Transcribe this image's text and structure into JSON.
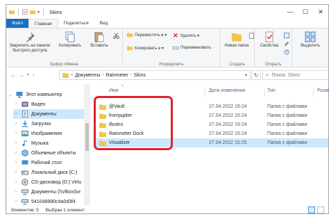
{
  "window": {
    "title": "Skins",
    "controls": [
      "—",
      "☐",
      "✕"
    ]
  },
  "ribbon_tabs": [
    "Файл",
    "Главная",
    "Поделиться",
    "Вид"
  ],
  "ribbon": {
    "clipboard": {
      "pin": "Закрепить на панели быстрого доступа",
      "copy": "Копировать",
      "paste": "Вставить",
      "group": "Буфер обмена"
    },
    "organize": {
      "move_to": "Переместить в ▾",
      "copy_to": "Копировать в ▾",
      "delete": "Удалить ▾",
      "rename": "Переименовать",
      "group": "Упорядочить"
    },
    "new": {
      "new_folder": "Новая папка",
      "group": "Создать"
    },
    "open": {
      "properties": "Свойства",
      "group": "Открыть"
    },
    "select": {
      "select_all": "Выделить",
      "group": ""
    }
  },
  "address": {
    "lead": "«",
    "crumbs": [
      "Документы",
      "Rainmeter",
      "Skins"
    ],
    "search_placeholder": "Поиск: Skins"
  },
  "nav_pane": [
    {
      "label": "Этот компьютер",
      "icon": "computer-icon",
      "expanded": true,
      "selected": false
    },
    {
      "label": "Видео",
      "icon": "video-folder-icon",
      "expanded": false,
      "selected": false
    },
    {
      "label": "Документы",
      "icon": "documents-folder-icon",
      "expanded": false,
      "selected": true
    },
    {
      "label": "Загрузки",
      "icon": "downloads-folder-icon",
      "expanded": false,
      "selected": false
    },
    {
      "label": "Изображения",
      "icon": "pictures-folder-icon",
      "expanded": false,
      "selected": false
    },
    {
      "label": "Музыка",
      "icon": "music-folder-icon",
      "expanded": false,
      "selected": false
    },
    {
      "label": "Объемные объекты",
      "icon": "3d-objects-icon",
      "expanded": false,
      "selected": false
    },
    {
      "label": "Рабочий стол",
      "icon": "desktop-folder-icon",
      "expanded": false,
      "selected": false
    },
    {
      "label": "Локальный диск (C:)",
      "icon": "drive-icon",
      "expanded": false,
      "selected": false
    },
    {
      "label": "CD-дисковод (D:) Virtu",
      "icon": "cd-drive-icon",
      "expanded": false,
      "selected": false
    },
    {
      "label": "Документы (\\\\VBoxSvr",
      "icon": "network-drive-icon",
      "expanded": false,
      "selected": false
    },
    {
      "label": "541048990c4a0d3f4",
      "icon": "network-drive-icon",
      "expanded": false,
      "selected": false
    }
  ],
  "file_list": {
    "columns": [
      "Имя",
      "Дата изменения",
      "Тип",
      "Разм"
    ],
    "rows": [
      {
        "name": "@Vault",
        "date": "27.04.2022 15:24",
        "type": "Папка с файлами",
        "selected": false
      },
      {
        "name": "fromjupiter",
        "date": "27.04.2022 15:24",
        "type": "Папка с файлами",
        "selected": false
      },
      {
        "name": "illustro",
        "date": "27.04.2022 15:24",
        "type": "Папка с файлами",
        "selected": false
      },
      {
        "name": "Rainmeter Dock",
        "date": "27.04.2022 15:24",
        "type": "Папка с файлами",
        "selected": false
      },
      {
        "name": "Visualizer",
        "date": "27.04.2022 15:25",
        "type": "Папка с файлами",
        "selected": true
      }
    ]
  },
  "status": {
    "items": "Элементов: 5",
    "selected": "Выбран 1 элемент"
  },
  "colors": {
    "accent": "#1a6fc2",
    "selection": "#cce8ff",
    "folder": "#f3c34d",
    "highlight_box": "#e0202a"
  }
}
